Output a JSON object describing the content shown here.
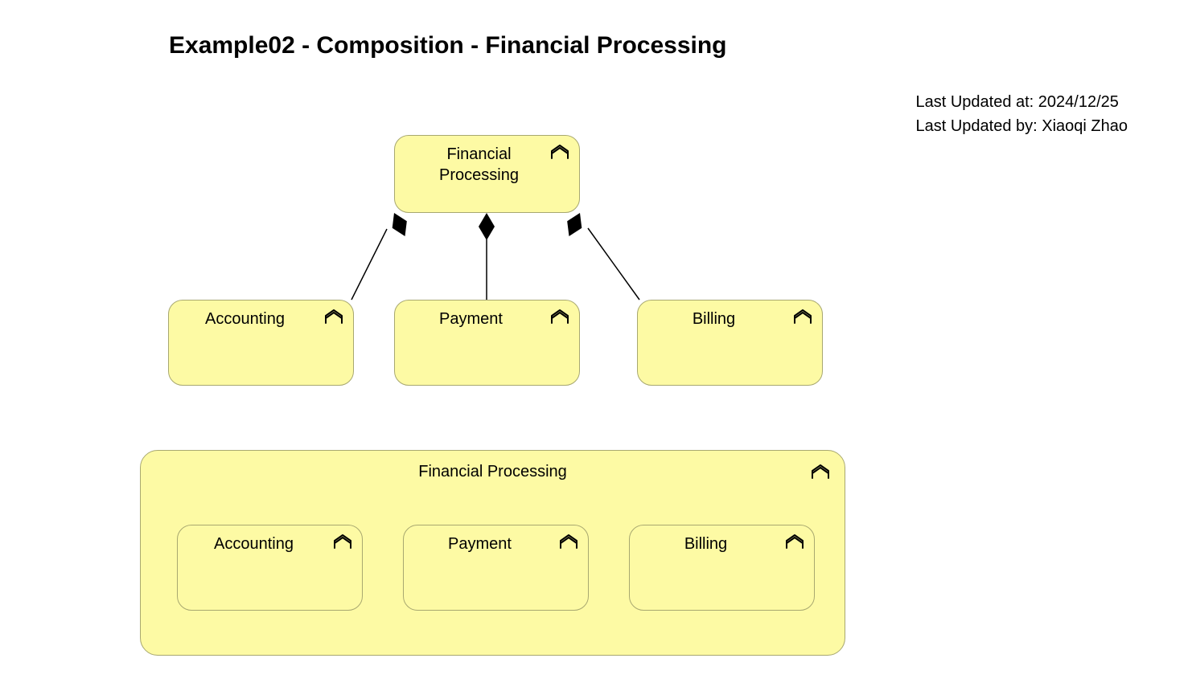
{
  "title": "Example02 - Composition - Financial Processing",
  "meta": {
    "updated_at_label": "Last Updated at: ",
    "updated_at": "2024/12/25",
    "updated_by_label": "Last Updated by: ",
    "updated_by": "Xiaoqi Zhao"
  },
  "diagram_top": {
    "parent": "Financial Processing",
    "children": [
      "Accounting",
      "Payment",
      "Billing"
    ]
  },
  "diagram_bottom": {
    "container": "Financial Processing",
    "children": [
      "Accounting",
      "Payment",
      "Billing"
    ]
  },
  "colors": {
    "box_fill": "#fdfaa4",
    "box_border": "#a8a870"
  }
}
